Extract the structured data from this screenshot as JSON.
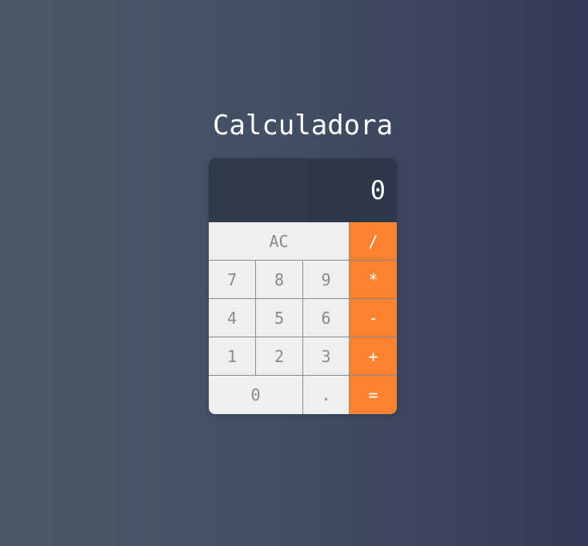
{
  "app": {
    "title": "Calculadora"
  },
  "display": {
    "value": "0"
  },
  "keys": {
    "ac": "AC",
    "divide": "/",
    "seven": "7",
    "eight": "8",
    "nine": "9",
    "multiply": "*",
    "four": "4",
    "five": "5",
    "six": "6",
    "subtract": "-",
    "one": "1",
    "two": "2",
    "three": "3",
    "add": "+",
    "zero": "0",
    "decimal": ".",
    "equals": "="
  },
  "colors": {
    "operator": "#fa8231",
    "key": "#efefef",
    "display": "#2f3a49"
  }
}
